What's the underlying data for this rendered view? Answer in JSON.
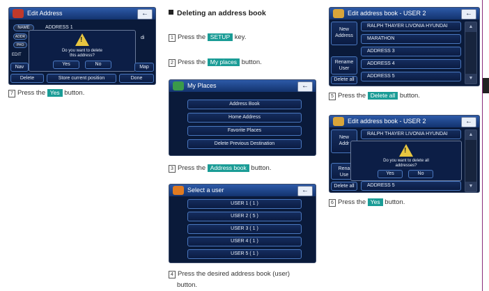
{
  "screen1": {
    "title": "Edit Address",
    "field_name": "NAME",
    "field_name_value": "ADDRESS 1",
    "field_addr": "ADDR",
    "field_phone": "PHO",
    "edit_label": "EDIT",
    "right_frag": "di",
    "dialog_text_1": "Do you want to delete",
    "dialog_text_2": "this address?",
    "yes": "Yes",
    "no": "No",
    "nav_left": "Nav",
    "map": "Map",
    "delete": "Delete",
    "store": "Store current position",
    "done": "Done"
  },
  "step7": {
    "num": "7",
    "pre": "Press the",
    "key": "Yes",
    "post": "button."
  },
  "heading": "Deleting an address book",
  "step1": {
    "num": "1",
    "pre": "Press the",
    "key": "SETUP",
    "post": "key."
  },
  "step2": {
    "num": "2",
    "pre": "Press the",
    "key": "My places",
    "post": "button."
  },
  "screen_places": {
    "title": "My Places",
    "items": [
      "Address Book",
      "Home Address",
      "Favorite Places",
      "Delete Previous Destination"
    ]
  },
  "step3": {
    "num": "3",
    "pre": "Press the",
    "key": "Address book",
    "post": "button."
  },
  "screen_user": {
    "title": "Select a user",
    "items": [
      "USER 1 ( 1 )",
      "USER 2 ( 5 )",
      "USER 3 ( 1 )",
      "USER 4 ( 1 )",
      "USER 5 ( 1 )"
    ]
  },
  "step4": {
    "num": "4",
    "pre": "Press the desired address book (user)",
    "line2": "button."
  },
  "screen_book": {
    "title": "Edit address book - USER 2",
    "new_address_1": "New",
    "new_address_2": "Address",
    "rename_1": "Rename",
    "rename_2": "User",
    "delete_all": "Delete all",
    "entries": [
      "RALPH THAYER LIVONIA HYUNDAI",
      "MARATHON",
      "ADDRESS 3",
      "ADDRESS 4",
      "ADDRESS 5"
    ]
  },
  "step5": {
    "num": "5",
    "pre": "Press the",
    "key": "Delete all",
    "post": "button."
  },
  "screen_confirm": {
    "title": "Edit address book - USER 2",
    "new_frag_1": "New",
    "new_frag_2": "Addr",
    "rename_frag_1": "Rena",
    "rename_frag_2": "Use",
    "delete_all": "Delete all",
    "entry_top": "RALPH THAYER LIVONIA HYUNDAI",
    "entry_bottom": "ADDRESS 5",
    "dialog_text_1": "Do you want to delete all",
    "dialog_text_2": "addresses?",
    "yes": "Yes",
    "no": "No"
  },
  "step6": {
    "num": "6",
    "pre": "Press the",
    "key": "Yes",
    "post": "button."
  },
  "colors": {
    "key_teal": "#1a9c96",
    "screen_bg": "#0a1a3a",
    "button_border": "#4a78c0"
  }
}
